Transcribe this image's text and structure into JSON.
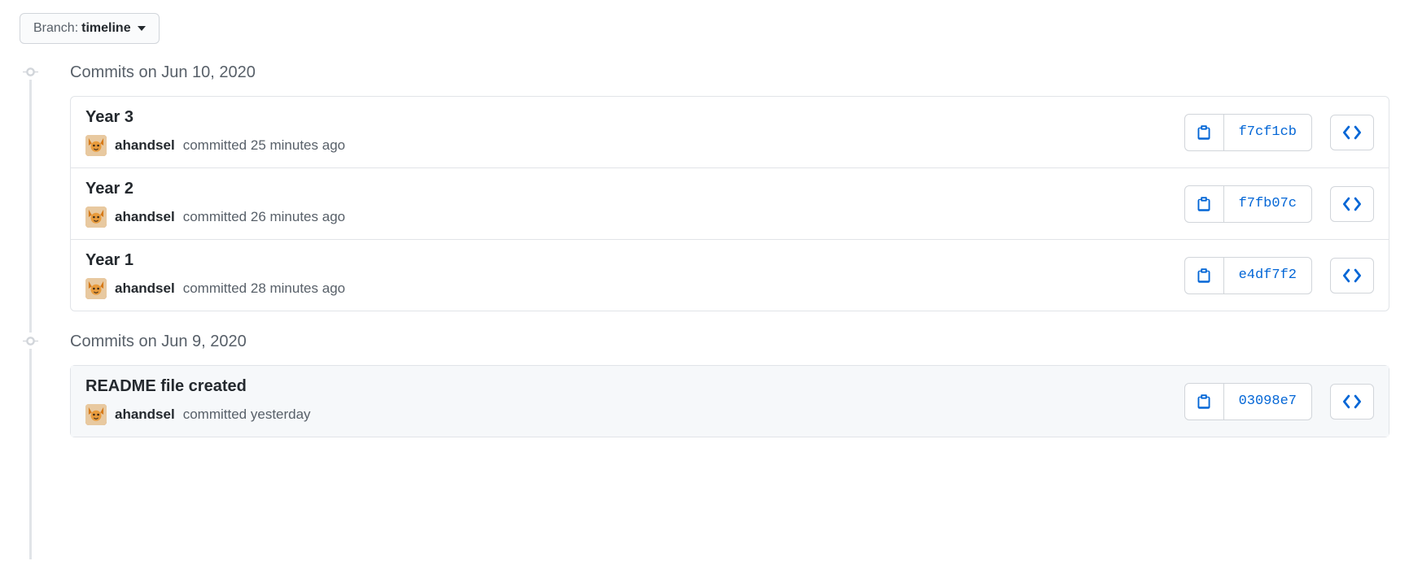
{
  "branch_selector": {
    "label": "Branch:",
    "name": "timeline"
  },
  "groups": [
    {
      "heading": "Commits on Jun 10, 2020",
      "commits": [
        {
          "title": "Year 3",
          "author": "ahandsel",
          "meta_prefix": "committed",
          "time": "25 minutes ago",
          "sha": "f7cf1cb",
          "highlighted": false
        },
        {
          "title": "Year 2",
          "author": "ahandsel",
          "meta_prefix": "committed",
          "time": "26 minutes ago",
          "sha": "f7fb07c",
          "highlighted": false
        },
        {
          "title": "Year 1",
          "author": "ahandsel",
          "meta_prefix": "committed",
          "time": "28 minutes ago",
          "sha": "e4df7f2",
          "highlighted": false
        }
      ]
    },
    {
      "heading": "Commits on Jun 9, 2020",
      "commits": [
        {
          "title": "README file created",
          "author": "ahandsel",
          "meta_prefix": "committed",
          "time": "yesterday",
          "sha": "03098e7",
          "highlighted": true
        }
      ]
    }
  ]
}
